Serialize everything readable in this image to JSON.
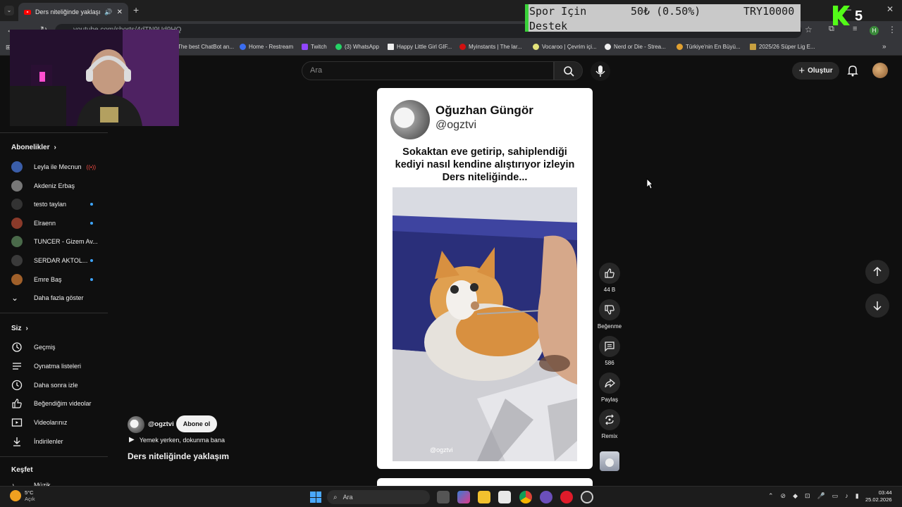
{
  "browser": {
    "tab_title": "Ders niteliğinde yaklaşım",
    "url": "youtube.com/shorts/4dTN9Ud9HQ",
    "bookmarks": [
      "The best ChatBot an...",
      "Home - Restream",
      "Twitch",
      "(3) WhatsApp",
      "Happy Little Girl GIF...",
      "Myinstants | The lar...",
      "Vocaroo | Çevrim içi...",
      "Nerd or Die - Strea...",
      "Türkiye'nin En Büyü...",
      "2025/26 Süper Lig E..."
    ]
  },
  "overlay": {
    "donation_line1": "Spor Için",
    "donation_amount": "50₺ (0.50%)",
    "donation_goal": "TRY10000",
    "donation_line2": "Destek",
    "kick_counter": "5",
    "accent_color": "#53fc18"
  },
  "header": {
    "search_placeholder": "Ara",
    "create_label": "Oluştur"
  },
  "sidebar": {
    "subscriptions_title": "Abonelikler",
    "channels": [
      {
        "name": "Leyla ile Mecnun",
        "indicator": "live"
      },
      {
        "name": "Akdeniz Erbaş",
        "indicator": "none"
      },
      {
        "name": "testo taylan",
        "indicator": "dot"
      },
      {
        "name": "Elraenn",
        "indicator": "dot"
      },
      {
        "name": "TUNCER - Gizem Av...",
        "indicator": "none"
      },
      {
        "name": "SERDAR AKTOL...",
        "indicator": "dot"
      },
      {
        "name": "Emre Baş",
        "indicator": "dot"
      }
    ],
    "show_more": "Daha fazla göster",
    "you_title": "Siz",
    "you_items": [
      {
        "label": "Geçmiş",
        "icon": "history-icon"
      },
      {
        "label": "Oynatma listeleri",
        "icon": "playlist-icon"
      },
      {
        "label": "Daha sonra izle",
        "icon": "clock-icon"
      },
      {
        "label": "Beğendiğim videolar",
        "icon": "thumbs-up-icon"
      },
      {
        "label": "Videolarınız",
        "icon": "video-icon"
      },
      {
        "label": "İndirilenler",
        "icon": "download-icon"
      }
    ],
    "explore_title": "Keşfet",
    "explore_partial": "Müzik"
  },
  "short": {
    "tweet_name": "Oğuzhan Güngör",
    "tweet_handle": "@ogztvi",
    "tweet_text": "Sokaktan eve getirip, sahiplendiği kediyi nasıl kendine alıştırıyor izleyin Ders niteliğinde...",
    "watermark": "@ogztvi",
    "channel_handle": "@ogztvi",
    "subscribe_label": "Abone ol",
    "music": "Yemek yerken, dokunma bana",
    "title": "Ders niteliğinde yaklaşım"
  },
  "actions": {
    "likes": "44 B",
    "dislike_label": "Beğenme",
    "comments": "586",
    "share_label": "Paylaş",
    "remix_label": "Remix"
  },
  "taskbar": {
    "weather_temp": "5°C",
    "weather_desc": "Açık",
    "search_label": "Ara",
    "time": "03:44",
    "date": "25.02.2026"
  }
}
